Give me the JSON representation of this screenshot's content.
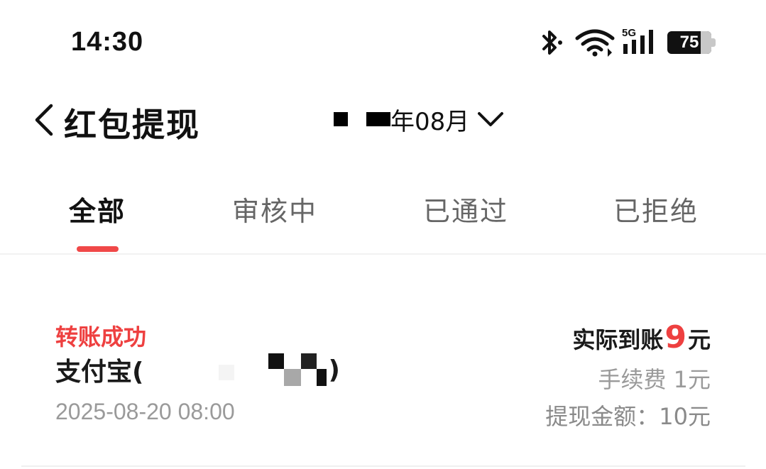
{
  "status_bar": {
    "time": "14:30",
    "network_label": "5G",
    "battery_level": "75",
    "battery_fraction": 0.75,
    "icons": [
      "bluetooth-icon",
      "wifi-icon",
      "cellular-signal-icon",
      "battery-icon"
    ]
  },
  "header": {
    "title": "红包提现",
    "month_suffix": "年08月",
    "icons": [
      "back-arrow-icon",
      "chevron-down-icon"
    ]
  },
  "tabs": [
    {
      "label": "全部",
      "active": true
    },
    {
      "label": "审核中",
      "active": false
    },
    {
      "label": "已通过",
      "active": false
    },
    {
      "label": "已拒绝",
      "active": false
    }
  ],
  "records": [
    {
      "status": "转账成功",
      "account_prefix": "支付宝(",
      "account_suffix": ")",
      "time": "2025-08-20 08:00",
      "actual_label": "实际到账",
      "actual_amount": "9",
      "actual_unit": "元",
      "fee": "手续费 1元",
      "total": "提现金额：10元"
    }
  ],
  "colors": {
    "accent": "#f04848",
    "status_success": "#ee4040",
    "text_primary": "#1a1a1a",
    "text_secondary": "#9a9a9a"
  }
}
